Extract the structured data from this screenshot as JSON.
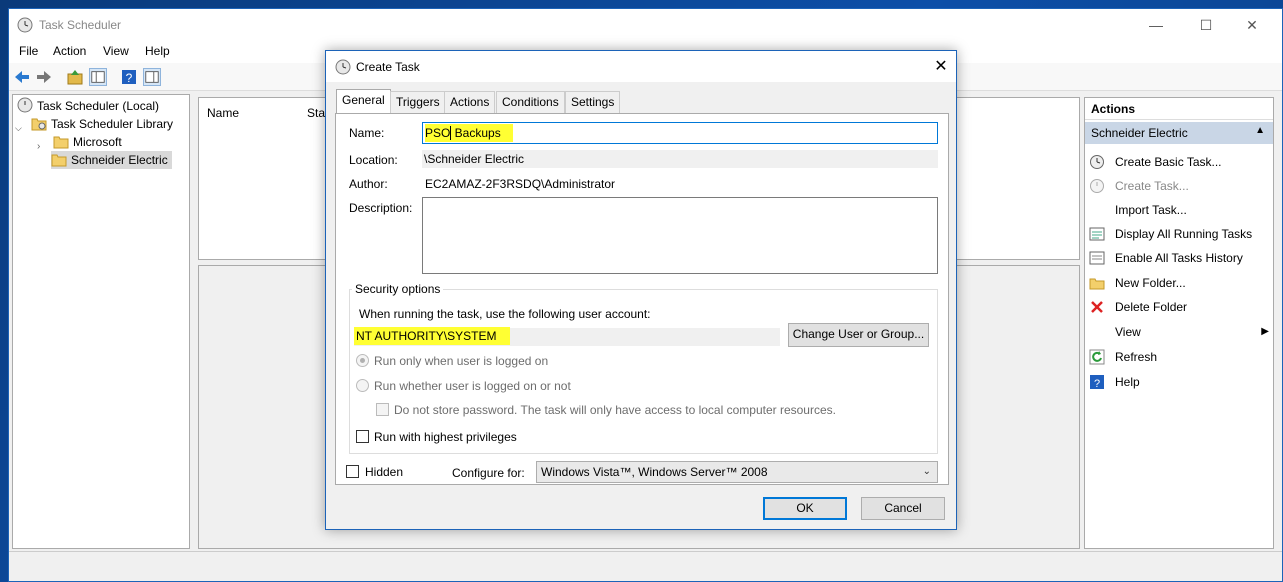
{
  "main": {
    "title": "Task Scheduler",
    "window_controls": {
      "minimize": "—",
      "maximize": "☐",
      "close": "✕"
    },
    "menu": [
      "File",
      "Action",
      "View",
      "Help"
    ],
    "tree": {
      "root": "Task Scheduler (Local)",
      "library": "Task Scheduler Library",
      "folders": [
        "Microsoft",
        "Schneider Electric"
      ],
      "selected": "Schneider Electric"
    },
    "list_columns": [
      "Name",
      "Stat"
    ]
  },
  "actions_pane": {
    "header": "Actions",
    "group": "Schneider Electric",
    "items": [
      {
        "label": "Create Basic Task...",
        "icon": "create-basic-task-icon",
        "enabled": true
      },
      {
        "label": "Create Task...",
        "icon": "create-task-icon",
        "enabled": false
      },
      {
        "label": "Import Task...",
        "icon": "",
        "enabled": true
      },
      {
        "label": "Display All Running Tasks",
        "icon": "running-tasks-icon",
        "enabled": true
      },
      {
        "label": "Enable All Tasks History",
        "icon": "history-icon",
        "enabled": true
      },
      {
        "label": "New Folder...",
        "icon": "folder-icon",
        "enabled": true
      },
      {
        "label": "Delete Folder",
        "icon": "delete-icon",
        "enabled": true
      },
      {
        "label": "View",
        "icon": "",
        "enabled": true
      },
      {
        "label": "Refresh",
        "icon": "refresh-icon",
        "enabled": true
      },
      {
        "label": "Help",
        "icon": "help-icon",
        "enabled": true
      }
    ]
  },
  "dialog": {
    "title": "Create Task",
    "tabs": [
      "General",
      "Triggers",
      "Actions",
      "Conditions",
      "Settings"
    ],
    "active_tab": "General",
    "name_label": "Name:",
    "name_value_part1": "PSO",
    "name_value_part2": " Backups",
    "location_label": "Location:",
    "location_value": "\\Schneider Electric",
    "author_label": "Author:",
    "author_value": "EC2AMAZ-2F3RSDQ\\Administrator",
    "description_label": "Description:",
    "description_value": "",
    "security": {
      "title": "Security options",
      "account_prompt": "When running the task, use the following user account:",
      "account_value": "NT AUTHORITY\\SYSTEM",
      "change_button": "Change User or Group...",
      "radio_logged_on": "Run only when user is logged on",
      "radio_whether": "Run whether user is logged on or not",
      "no_store_password": "Do not store password.  The task will only have access to local computer resources.",
      "highest_privileges": "Run with highest privileges"
    },
    "hidden_label": "Hidden",
    "configure_label": "Configure for:",
    "configure_value": "Windows Vista™, Windows Server™ 2008",
    "ok": "OK",
    "cancel": "Cancel"
  },
  "colors": {
    "accent": "#0078d7",
    "highlight": "#ffff33",
    "selection": "#c9d6e6"
  }
}
